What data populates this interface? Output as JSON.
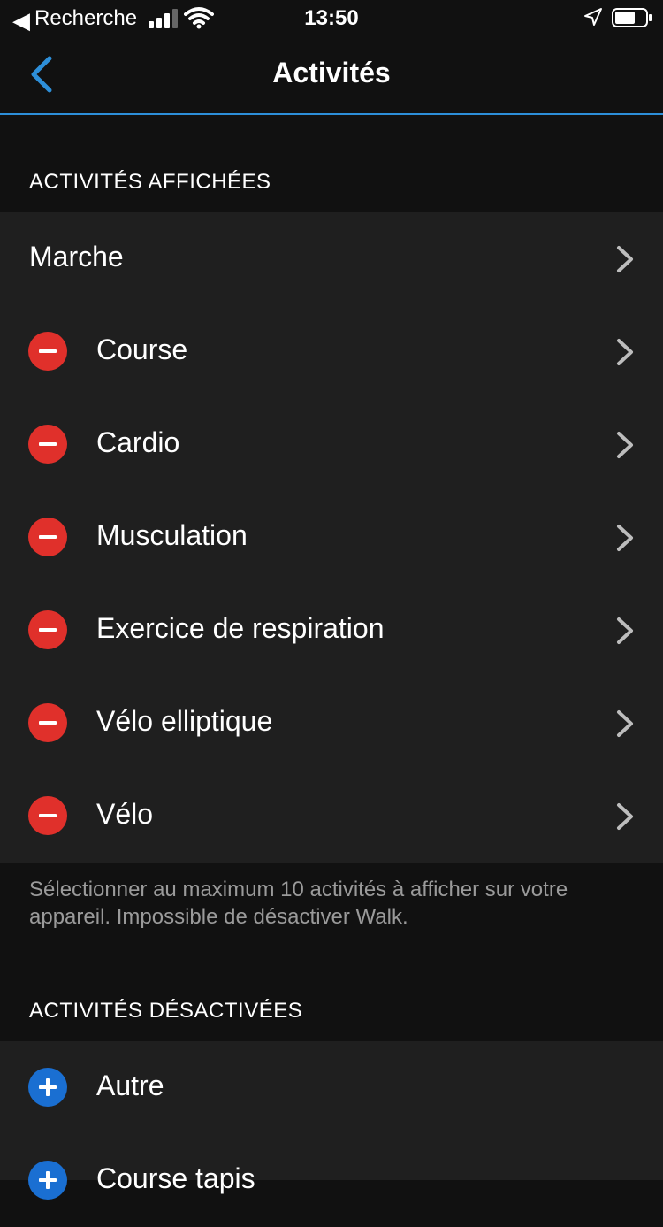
{
  "status_bar": {
    "back_arrow": "◀",
    "back_app": "Recherche",
    "time": "13:50",
    "icons": [
      "signal-icon",
      "wifi-icon",
      "location-icon",
      "battery-icon"
    ]
  },
  "nav": {
    "title": "Activités",
    "back_icon": "chevron-left-icon",
    "accent_color": "#2d8fd9"
  },
  "displayed_section": {
    "header": "ACTIVITÉS AFFICHÉES",
    "items": [
      {
        "label": "Marche",
        "removable": false
      },
      {
        "label": "Course",
        "removable": true
      },
      {
        "label": "Cardio",
        "removable": true
      },
      {
        "label": "Musculation",
        "removable": true
      },
      {
        "label": "Exercice de respiration",
        "removable": true
      },
      {
        "label": "Vélo elliptique",
        "removable": true
      },
      {
        "label": "Vélo",
        "removable": true
      }
    ],
    "footer": "Sélectionner au maximum 10 activités à afficher sur votre appareil. Impossible de désactiver Walk."
  },
  "disabled_section": {
    "header": "ACTIVITÉS DÉSACTIVÉES",
    "items": [
      {
        "label": "Autre"
      },
      {
        "label": "Course tapis"
      }
    ]
  },
  "colors": {
    "remove": "#e0302b",
    "add": "#1a6fd2",
    "background": "#111111",
    "row_background": "#1f1f1f"
  }
}
